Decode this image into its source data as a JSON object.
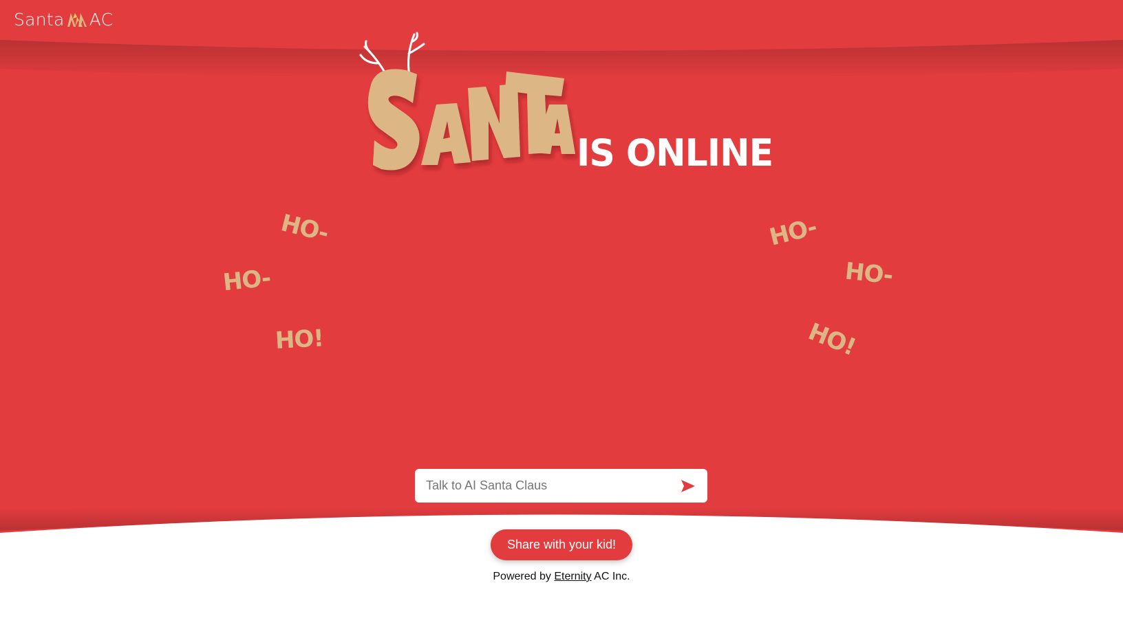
{
  "brand": {
    "name_left": "Santa",
    "name_right": "AC",
    "icon": "christmas-trees-icon"
  },
  "hero": {
    "title_main": "SANTA",
    "title_rest": "IS ONLINE",
    "ho_left": [
      "HO-",
      "HO-",
      "HO!"
    ],
    "ho_right": [
      "HO-",
      "HO-",
      "HO!"
    ]
  },
  "chat": {
    "placeholder": "Talk to AI Santa Claus",
    "send_icon": "send-arrow-icon"
  },
  "share": {
    "label": "Share with your kid!"
  },
  "footer": {
    "prefix": "Powered by",
    "link": "Eternity",
    "suffix": "AC Inc."
  },
  "colors": {
    "primary_red": "#e23c3e",
    "tan": "#dcb785",
    "white": "#ffffff"
  }
}
